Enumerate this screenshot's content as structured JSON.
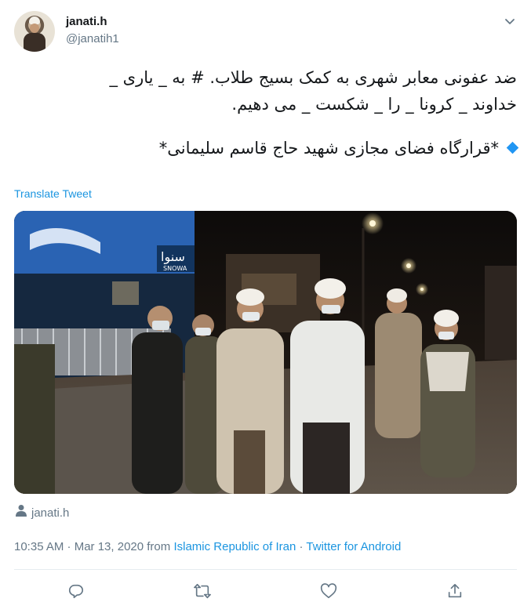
{
  "user": {
    "name": "janati.h",
    "handle": "@janatih1"
  },
  "tweet": {
    "line1": "ضد عفونی معابر شهری به کمک بسیج طلاب. # به _ یاری _",
    "line2": "خداوند _ کرونا _ را _ شکست _ می دهیم.",
    "line3": "*قرارگاه فضای مجازی شهید حاج  قاسم سلیمانی*"
  },
  "translate_label": "Translate Tweet",
  "photo": {
    "shop_sign": "سنوا",
    "shop_sign_latin": "SNOWA"
  },
  "tagged_user": "janati.h",
  "meta": {
    "timestamp": "10:35 AM · Mar 13, 2020 from ",
    "location": "Islamic Republic of Iran",
    "separator": " · ",
    "source": "Twitter for Android"
  },
  "icons": {
    "reply": "reply-icon",
    "retweet": "retweet-icon",
    "like": "heart-icon",
    "share": "share-icon",
    "caret": "chevron-down-icon",
    "person": "person-icon"
  }
}
